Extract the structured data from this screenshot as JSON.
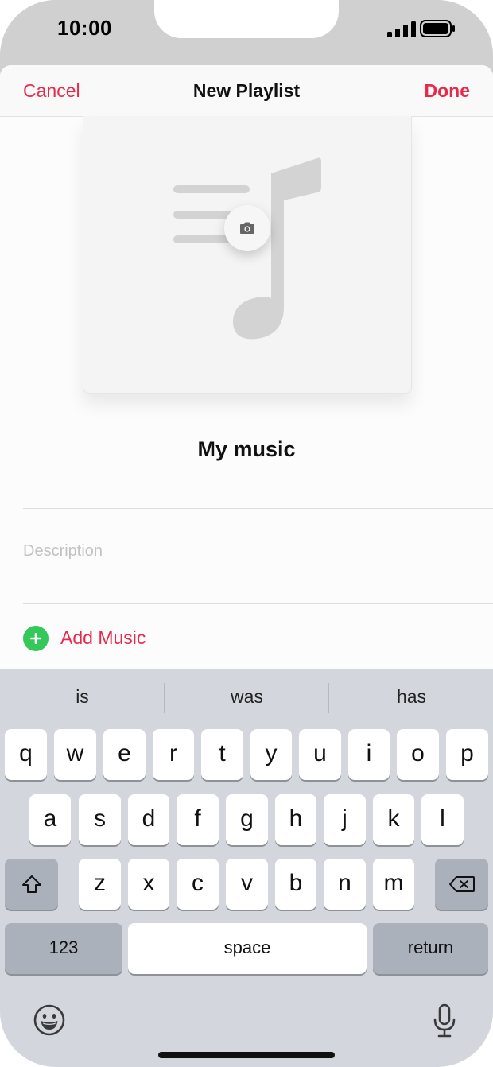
{
  "status_bar": {
    "time": "10:00"
  },
  "navbar": {
    "cancel": "Cancel",
    "title": "New Playlist",
    "done": "Done"
  },
  "playlist": {
    "name": "My music",
    "description_placeholder": "Description",
    "add_music": "Add Music"
  },
  "keyboard": {
    "suggestions": [
      "is",
      "was",
      "has"
    ],
    "row1": [
      "q",
      "w",
      "e",
      "r",
      "t",
      "y",
      "u",
      "i",
      "o",
      "p"
    ],
    "row2": [
      "a",
      "s",
      "d",
      "f",
      "g",
      "h",
      "j",
      "k",
      "l"
    ],
    "row3": [
      "z",
      "x",
      "c",
      "v",
      "b",
      "n",
      "m"
    ],
    "numbers": "123",
    "space": "space",
    "return": "return"
  },
  "colors": {
    "accent": "#e8294c",
    "add_green": "#34c759",
    "keyboard_bg": "#d3d6dd"
  },
  "icons": [
    "camera-icon",
    "plus-icon",
    "shift-icon",
    "delete-icon",
    "emoji-icon",
    "microphone-icon",
    "signal-icon",
    "battery-icon"
  ]
}
